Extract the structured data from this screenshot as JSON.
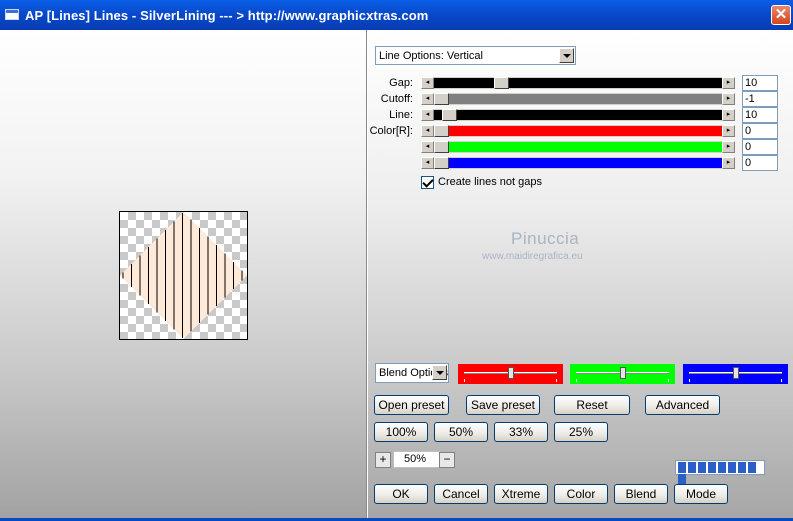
{
  "window": {
    "title": "AP [Lines]  Lines - SilverLining     --- > http://www.graphicxtras.com",
    "close_label": "✕"
  },
  "preview": {
    "stripe_color": "#ffe9d9",
    "line_color": "#000000"
  },
  "line_options": {
    "selected": "Line Options: Vertical"
  },
  "sliders": [
    {
      "label": "Gap:",
      "value": "10",
      "track_color": "#000000",
      "position": 0.22
    },
    {
      "label": "Cutoff:",
      "value": "-1",
      "track_color": "#808080",
      "position": 0.0
    },
    {
      "label": "Line:",
      "value": "10",
      "track_color": "#000000",
      "position": 0.03
    },
    {
      "label": "Color[R]:",
      "value": "0",
      "track_color": "#ff0000",
      "position": 0.0
    },
    {
      "label": "",
      "value": "0",
      "track_color": "#00ff00",
      "position": 0.0
    },
    {
      "label": "",
      "value": "0",
      "track_color": "#0000ff",
      "position": 0.0
    }
  ],
  "checkbox": {
    "label": "Create lines not gaps",
    "checked": true
  },
  "watermark": {
    "name": "Pinuccia",
    "url": "www.maidiregrafica.eu"
  },
  "blend": {
    "selected": "Blend Options",
    "colors": [
      "#ff0000",
      "#00ff00",
      "#0000ff"
    ],
    "positions": [
      0.5,
      0.5,
      0.5
    ]
  },
  "buttons": {
    "open_preset": "Open preset",
    "save_preset": "Save preset",
    "reset": "Reset",
    "advanced": "Advanced",
    "zoom_100": "100%",
    "zoom_50": "50%",
    "zoom_33": "33%",
    "zoom_25": "25%",
    "ok": "OK",
    "cancel": "Cancel",
    "xtreme": "Xtreme",
    "color": "Color",
    "blend": "Blend",
    "mode": "Mode"
  },
  "zoom": {
    "plus": "+",
    "minus": "−",
    "value": "50%"
  },
  "progress": {
    "segments": 9
  }
}
